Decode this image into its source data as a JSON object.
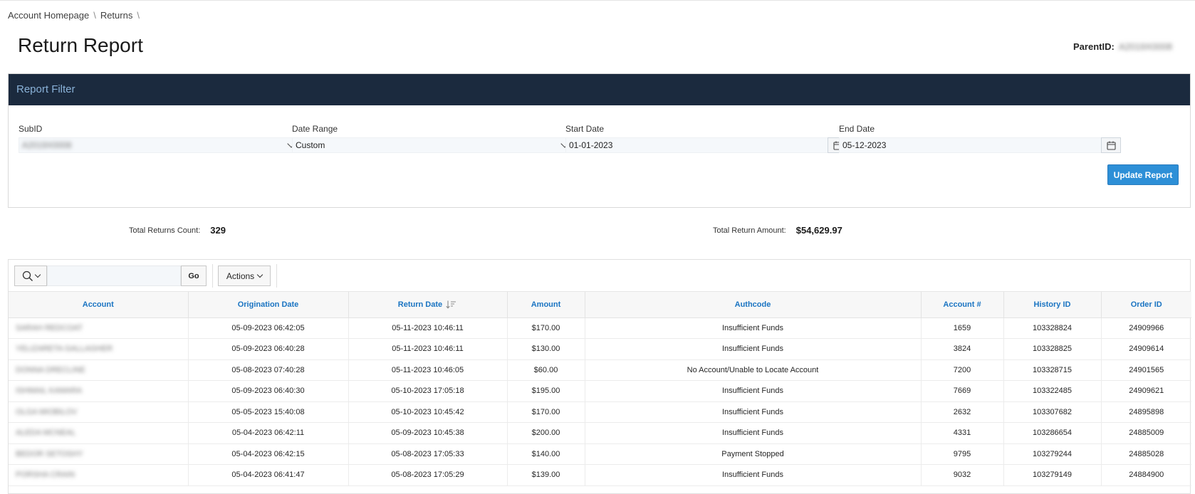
{
  "breadcrumb": [
    "Account Homepage",
    "Returns"
  ],
  "page_title": "Return Report",
  "parent_id": {
    "label": "ParentID:",
    "value": "A2019X0008"
  },
  "filter": {
    "title": "Report Filter",
    "subid": {
      "label": "SubID",
      "value": "A2019X0008"
    },
    "date_range": {
      "label": "Date Range",
      "value": "Custom"
    },
    "start_date": {
      "label": "Start Date",
      "value": "01-01-2023"
    },
    "end_date": {
      "label": "End Date",
      "value": "05-12-2023"
    },
    "update_label": "Update Report"
  },
  "summary": {
    "count_label": "Total Returns Count:",
    "count_value": "329",
    "amount_label": "Total Return Amount:",
    "amount_value": "$54,629.97"
  },
  "toolbar": {
    "go_label": "Go",
    "actions_label": "Actions",
    "search_placeholder": ""
  },
  "table": {
    "columns": [
      "Account",
      "Origination Date",
      "Return Date",
      "Amount",
      "Authcode",
      "Account #",
      "History ID",
      "Order ID"
    ],
    "rows": [
      [
        "SARAH REDCOAT",
        "05-09-2023 06:42:05",
        "05-11-2023 10:46:11",
        "$170.00",
        "Insufficient Funds",
        "1659",
        "103328824",
        "24909966"
      ],
      [
        "YELIZARETA GALLAGHER",
        "05-09-2023 06:40:28",
        "05-11-2023 10:46:11",
        "$130.00",
        "Insufficient Funds",
        "3824",
        "103328825",
        "24909614"
      ],
      [
        "DONNA DRECLINE",
        "05-08-2023 07:40:28",
        "05-11-2023 10:46:05",
        "$60.00",
        "No Account/Unable to Locate Account",
        "7200",
        "103328715",
        "24901565"
      ],
      [
        "ISHMAIL KAMARA",
        "05-09-2023 06:40:30",
        "05-10-2023 17:05:18",
        "$195.00",
        "Insufficient Funds",
        "7669",
        "103322485",
        "24909621"
      ],
      [
        "OLGA MIOBILOV",
        "05-05-2023 15:40:08",
        "05-10-2023 10:45:42",
        "$170.00",
        "Insufficient Funds",
        "2632",
        "103307682",
        "24895898"
      ],
      [
        "ALEDA MCNEAL",
        "05-04-2023 06:42:11",
        "05-09-2023 10:45:38",
        "$200.00",
        "Insufficient Funds",
        "4331",
        "103286654",
        "24885009"
      ],
      [
        "BEDOR SETOSHY",
        "05-04-2023 06:42:15",
        "05-08-2023 17:05:33",
        "$140.00",
        "Payment Stopped",
        "9795",
        "103279244",
        "24885028"
      ],
      [
        "PORSHA CRAIN",
        "05-04-2023 06:41:47",
        "05-08-2023 17:05:29",
        "$139.00",
        "Insufficient Funds",
        "9032",
        "103279149",
        "24884900"
      ]
    ]
  }
}
